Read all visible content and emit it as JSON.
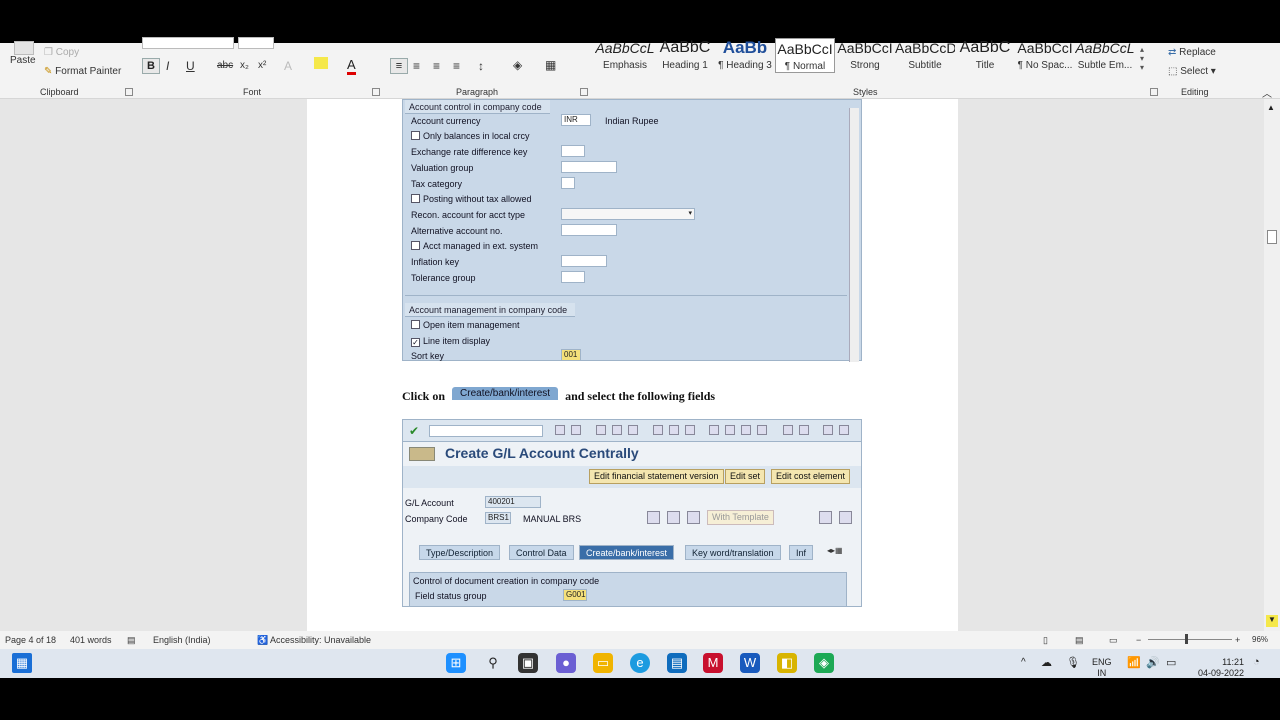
{
  "ribbon": {
    "clipboard": {
      "copy": "Copy",
      "paste": "Paste",
      "format_painter": "Format Painter",
      "label": "Clipboard"
    },
    "font": {
      "bold": "B",
      "italic": "I",
      "underline": "U",
      "strike": "abc",
      "sub": "x₂",
      "sup": "x²",
      "font_color": "A",
      "label": "Font"
    },
    "paragraph": {
      "label": "Paragraph"
    },
    "styles": {
      "label": "Styles",
      "items": [
        {
          "preview": "AaBbCcL",
          "name": "Emphasis"
        },
        {
          "preview": "AaBbC",
          "name": "Heading 1"
        },
        {
          "preview": "AaBb",
          "name": "¶ Heading 3"
        },
        {
          "preview": "AaBbCcI",
          "name": "¶ Normal"
        },
        {
          "preview": "AaBbCcI",
          "name": "Strong"
        },
        {
          "preview": "AaBbCcD",
          "name": "Subtitle"
        },
        {
          "preview": "AaBbC",
          "name": "Title"
        },
        {
          "preview": "AaBbCcI",
          "name": "¶ No Spac..."
        },
        {
          "preview": "AaBbCcL",
          "name": "Subtle Em..."
        }
      ]
    },
    "editing": {
      "replace": "Replace",
      "select": "Select",
      "label": "Editing"
    }
  },
  "sap_top": {
    "section1": "Account control in company code",
    "account_currency_label": "Account currency",
    "account_currency_value": "INR",
    "account_currency_text": "Indian Rupee",
    "only_balances": "Only balances in local crcy",
    "exchange_rate": "Exchange rate difference key",
    "valuation_group": "Valuation group",
    "tax_category": "Tax category",
    "posting_without_tax": "Posting without tax allowed",
    "recon_account": "Recon. account for acct type",
    "alternative_account": "Alternative account no.",
    "acct_managed": "Acct managed in ext. system",
    "inflation_key": "Inflation key",
    "tolerance_group": "Tolerance group",
    "section2": "Account management in company code",
    "open_item": "Open item management",
    "line_item": "Line item display",
    "sort_key_label": "Sort key",
    "sort_key_value": "001"
  },
  "caption": {
    "before": "Click on",
    "tab": "Create/bank/interest",
    "after": "and select the following fields"
  },
  "sap_bottom": {
    "title": "Create G/L Account Centrally",
    "btn_fin": "Edit financial statement version",
    "btn_set": "Edit set",
    "btn_cost": "Edit cost element",
    "gl_label": "G/L Account",
    "gl_value": "400201",
    "cc_label": "Company Code",
    "cc_value": "BRS1",
    "cc_text": "MANUAL BRS",
    "with_template": "With Template",
    "tabs": [
      "Type/Description",
      "Control Data",
      "Create/bank/interest",
      "Key word/translation",
      "Inf"
    ],
    "section": "Control of document creation in company code",
    "fsg_label": "Field status group",
    "fsg_value": "G001"
  },
  "status": {
    "page": "Page 4 of 18",
    "words": "401 words",
    "language": "English (India)",
    "accessibility": "Accessibility: Unavailable",
    "zoom": "96%"
  },
  "taskbar": {
    "lang1": "ENG",
    "lang2": "IN",
    "time": "11:21",
    "date": "04-09-2022"
  }
}
